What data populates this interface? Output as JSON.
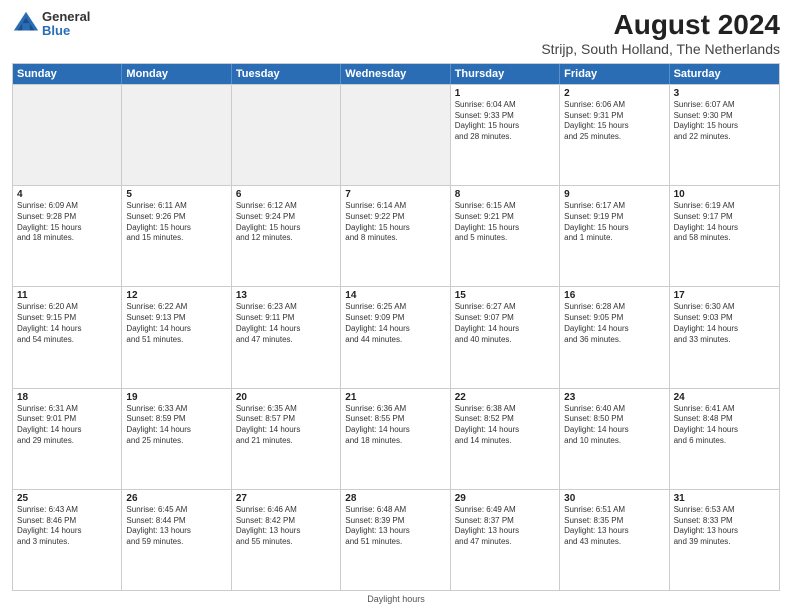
{
  "header": {
    "logo_line1": "General",
    "logo_line2": "Blue",
    "title": "August 2024",
    "subtitle": "Strijp, South Holland, The Netherlands"
  },
  "weekdays": [
    "Sunday",
    "Monday",
    "Tuesday",
    "Wednesday",
    "Thursday",
    "Friday",
    "Saturday"
  ],
  "footer": "Daylight hours",
  "weeks": [
    [
      {
        "day": "",
        "info": "",
        "shaded": true
      },
      {
        "day": "",
        "info": "",
        "shaded": true
      },
      {
        "day": "",
        "info": "",
        "shaded": true
      },
      {
        "day": "",
        "info": "",
        "shaded": true
      },
      {
        "day": "1",
        "info": "Sunrise: 6:04 AM\nSunset: 9:33 PM\nDaylight: 15 hours\nand 28 minutes.",
        "shaded": false
      },
      {
        "day": "2",
        "info": "Sunrise: 6:06 AM\nSunset: 9:31 PM\nDaylight: 15 hours\nand 25 minutes.",
        "shaded": false
      },
      {
        "day": "3",
        "info": "Sunrise: 6:07 AM\nSunset: 9:30 PM\nDaylight: 15 hours\nand 22 minutes.",
        "shaded": false
      }
    ],
    [
      {
        "day": "4",
        "info": "Sunrise: 6:09 AM\nSunset: 9:28 PM\nDaylight: 15 hours\nand 18 minutes.",
        "shaded": false
      },
      {
        "day": "5",
        "info": "Sunrise: 6:11 AM\nSunset: 9:26 PM\nDaylight: 15 hours\nand 15 minutes.",
        "shaded": false
      },
      {
        "day": "6",
        "info": "Sunrise: 6:12 AM\nSunset: 9:24 PM\nDaylight: 15 hours\nand 12 minutes.",
        "shaded": false
      },
      {
        "day": "7",
        "info": "Sunrise: 6:14 AM\nSunset: 9:22 PM\nDaylight: 15 hours\nand 8 minutes.",
        "shaded": false
      },
      {
        "day": "8",
        "info": "Sunrise: 6:15 AM\nSunset: 9:21 PM\nDaylight: 15 hours\nand 5 minutes.",
        "shaded": false
      },
      {
        "day": "9",
        "info": "Sunrise: 6:17 AM\nSunset: 9:19 PM\nDaylight: 15 hours\nand 1 minute.",
        "shaded": false
      },
      {
        "day": "10",
        "info": "Sunrise: 6:19 AM\nSunset: 9:17 PM\nDaylight: 14 hours\nand 58 minutes.",
        "shaded": false
      }
    ],
    [
      {
        "day": "11",
        "info": "Sunrise: 6:20 AM\nSunset: 9:15 PM\nDaylight: 14 hours\nand 54 minutes.",
        "shaded": false
      },
      {
        "day": "12",
        "info": "Sunrise: 6:22 AM\nSunset: 9:13 PM\nDaylight: 14 hours\nand 51 minutes.",
        "shaded": false
      },
      {
        "day": "13",
        "info": "Sunrise: 6:23 AM\nSunset: 9:11 PM\nDaylight: 14 hours\nand 47 minutes.",
        "shaded": false
      },
      {
        "day": "14",
        "info": "Sunrise: 6:25 AM\nSunset: 9:09 PM\nDaylight: 14 hours\nand 44 minutes.",
        "shaded": false
      },
      {
        "day": "15",
        "info": "Sunrise: 6:27 AM\nSunset: 9:07 PM\nDaylight: 14 hours\nand 40 minutes.",
        "shaded": false
      },
      {
        "day": "16",
        "info": "Sunrise: 6:28 AM\nSunset: 9:05 PM\nDaylight: 14 hours\nand 36 minutes.",
        "shaded": false
      },
      {
        "day": "17",
        "info": "Sunrise: 6:30 AM\nSunset: 9:03 PM\nDaylight: 14 hours\nand 33 minutes.",
        "shaded": false
      }
    ],
    [
      {
        "day": "18",
        "info": "Sunrise: 6:31 AM\nSunset: 9:01 PM\nDaylight: 14 hours\nand 29 minutes.",
        "shaded": false
      },
      {
        "day": "19",
        "info": "Sunrise: 6:33 AM\nSunset: 8:59 PM\nDaylight: 14 hours\nand 25 minutes.",
        "shaded": false
      },
      {
        "day": "20",
        "info": "Sunrise: 6:35 AM\nSunset: 8:57 PM\nDaylight: 14 hours\nand 21 minutes.",
        "shaded": false
      },
      {
        "day": "21",
        "info": "Sunrise: 6:36 AM\nSunset: 8:55 PM\nDaylight: 14 hours\nand 18 minutes.",
        "shaded": false
      },
      {
        "day": "22",
        "info": "Sunrise: 6:38 AM\nSunset: 8:52 PM\nDaylight: 14 hours\nand 14 minutes.",
        "shaded": false
      },
      {
        "day": "23",
        "info": "Sunrise: 6:40 AM\nSunset: 8:50 PM\nDaylight: 14 hours\nand 10 minutes.",
        "shaded": false
      },
      {
        "day": "24",
        "info": "Sunrise: 6:41 AM\nSunset: 8:48 PM\nDaylight: 14 hours\nand 6 minutes.",
        "shaded": false
      }
    ],
    [
      {
        "day": "25",
        "info": "Sunrise: 6:43 AM\nSunset: 8:46 PM\nDaylight: 14 hours\nand 3 minutes.",
        "shaded": false
      },
      {
        "day": "26",
        "info": "Sunrise: 6:45 AM\nSunset: 8:44 PM\nDaylight: 13 hours\nand 59 minutes.",
        "shaded": false
      },
      {
        "day": "27",
        "info": "Sunrise: 6:46 AM\nSunset: 8:42 PM\nDaylight: 13 hours\nand 55 minutes.",
        "shaded": false
      },
      {
        "day": "28",
        "info": "Sunrise: 6:48 AM\nSunset: 8:39 PM\nDaylight: 13 hours\nand 51 minutes.",
        "shaded": false
      },
      {
        "day": "29",
        "info": "Sunrise: 6:49 AM\nSunset: 8:37 PM\nDaylight: 13 hours\nand 47 minutes.",
        "shaded": false
      },
      {
        "day": "30",
        "info": "Sunrise: 6:51 AM\nSunset: 8:35 PM\nDaylight: 13 hours\nand 43 minutes.",
        "shaded": false
      },
      {
        "day": "31",
        "info": "Sunrise: 6:53 AM\nSunset: 8:33 PM\nDaylight: 13 hours\nand 39 minutes.",
        "shaded": false
      }
    ]
  ]
}
